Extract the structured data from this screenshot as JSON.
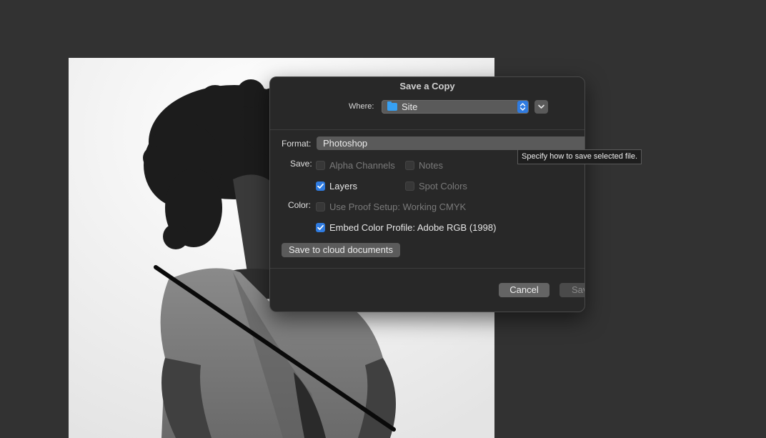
{
  "dialog": {
    "title": "Save a Copy",
    "where_label": "Where:",
    "where_value": "Site",
    "format_label": "Format:",
    "format_value": "Photoshop",
    "save_label": "Save:",
    "color_label": "Color:",
    "options": {
      "alpha_channels": {
        "label": "Alpha Channels",
        "checked": false,
        "enabled": false
      },
      "notes": {
        "label": "Notes",
        "checked": false,
        "enabled": false
      },
      "layers": {
        "label": "Layers",
        "checked": true,
        "enabled": true
      },
      "spot_colors": {
        "label": "Spot Colors",
        "checked": false,
        "enabled": false
      },
      "use_proof_setup": {
        "label": "Use Proof Setup:  Working CMYK",
        "checked": false,
        "enabled": false
      },
      "embed_color_profile": {
        "label": "Embed Color Profile:  Adobe RGB (1998)",
        "checked": true,
        "enabled": true
      }
    },
    "cloud_button": "Save to cloud documents",
    "cancel_button": "Cancel",
    "save_button": "Sav"
  },
  "tooltip": "Specify how to save selected file.",
  "colors": {
    "workspace": "#323232",
    "dialog_bg": "#282828",
    "accent": "#2f7be0",
    "folder": "#37a0f2"
  },
  "icons": [
    "folder-icon",
    "stepper-icon",
    "chevron-down-icon",
    "checkmark-icon"
  ]
}
